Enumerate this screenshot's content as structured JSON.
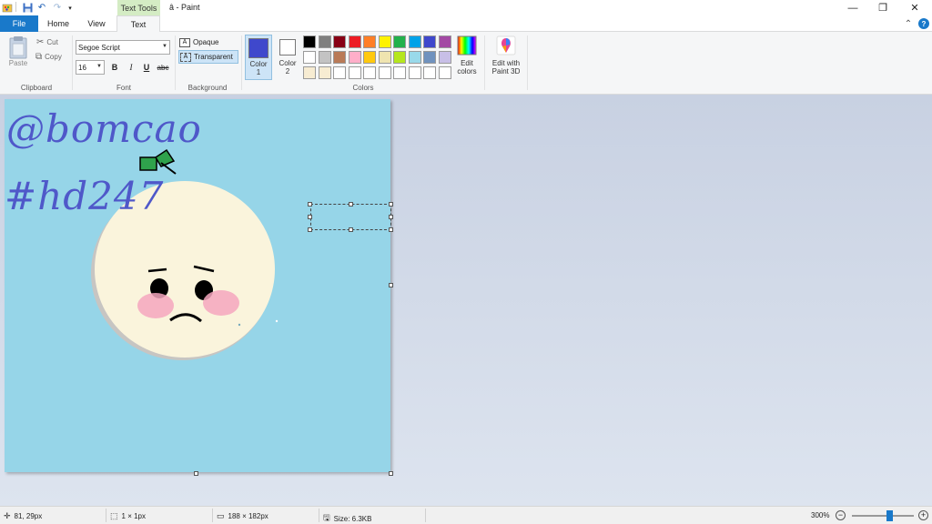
{
  "window": {
    "title": "â - Paint",
    "context_tab": "Text Tools",
    "minimize_glyph": "—",
    "restore_glyph": "❐",
    "close_glyph": "✕",
    "collapse_glyph": "⌃",
    "help_glyph": "?"
  },
  "tabs": {
    "file": "File",
    "home": "Home",
    "view": "View",
    "text": "Text"
  },
  "clipboard": {
    "paste": "Paste",
    "cut": "Cut",
    "copy": "Copy",
    "label": "Clipboard"
  },
  "font": {
    "family": "Segoe Script",
    "size": "16",
    "bold": "B",
    "italic": "I",
    "underline": "U",
    "strikethrough": "abc",
    "label": "Font"
  },
  "background": {
    "opaque": "Opaque",
    "transparent": "Transparent",
    "selected": "Transparent",
    "label": "Background"
  },
  "colors": {
    "color1_label": "Color",
    "color1_num": "1",
    "color2_label": "Color",
    "color2_num": "2",
    "color1_value": "#3f48cc",
    "color2_value": "#ffffff",
    "edit_colors_line1": "Edit",
    "edit_colors_line2": "colors",
    "label": "Colors",
    "palette": [
      "#000000",
      "#7f7f7f",
      "#880015",
      "#ed1c24",
      "#ff7f27",
      "#fff200",
      "#22b14c",
      "#00a2e8",
      "#3f48cc",
      "#a349a4",
      "#ffffff",
      "#c3c3c3",
      "#b97a57",
      "#ffaec9",
      "#ffc90e",
      "#efe4b0",
      "#b5e61d",
      "#99d9ea",
      "#7092be",
      "#c8bfe7",
      "#f7ecd2",
      "#f7ecd2",
      "#ffffff",
      "#ffffff",
      "#ffffff",
      "#ffffff",
      "#ffffff",
      "#ffffff",
      "#ffffff",
      "#ffffff"
    ]
  },
  "paint3d": {
    "line1": "Edit with",
    "line2": "Paint 3D"
  },
  "canvas": {
    "background_color": "#96d5e8",
    "text_line1": "@bomcao",
    "text_line2": "#hd247"
  },
  "status": {
    "cursor_pos": "81, 29px",
    "selection_size": "1 × 1px",
    "image_size": "188 × 182px",
    "file_size": "Size: 6.3KB",
    "zoom": "300%",
    "zoom_level": 0.6
  }
}
